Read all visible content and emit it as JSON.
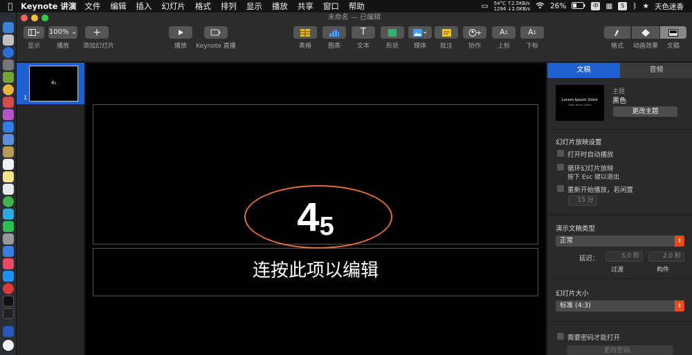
{
  "menubar": {
    "app_name": "Keynote 讲演",
    "items": [
      "文件",
      "编辑",
      "插入",
      "幻灯片",
      "格式",
      "排列",
      "显示",
      "播放",
      "共享",
      "窗口",
      "帮助"
    ],
    "status": {
      "net_line1": "54°C ↑2.5KB/s",
      "net_line2": "1294 ↓2.0KB/s",
      "battery": "26%",
      "input_method": "中",
      "user": "天色迷香"
    }
  },
  "window": {
    "title": "未命名 — 已编辑"
  },
  "toolbar": {
    "view": "显示",
    "zoom_value": "100%",
    "zoom": "播放",
    "add_slide": "添加幻灯片",
    "play": "播放",
    "keynote_live": "Keynote 直播",
    "table": "表格",
    "chart": "图表",
    "text": "文本",
    "shape": "形状",
    "media": "媒体",
    "comment": "批注",
    "collaborate": "协作",
    "superscript": "上标",
    "subscript": "下标",
    "format": "格式",
    "animate": "动画效果",
    "document": "文稿"
  },
  "navigator": {
    "slide_number": "1",
    "thumb_text": "4₅"
  },
  "slide": {
    "title_base": "4",
    "title_sub": "5",
    "body_placeholder": "连按此项以编辑"
  },
  "inspector": {
    "tabs": [
      "文稿",
      "音频"
    ],
    "theme_label": "主题",
    "theme_name": "黑色",
    "theme_thumb_title": "Lorem Ipsum Dolor",
    "theme_thumb_sub": "Dolor Ipsum Lorem",
    "change_theme": "更改主题",
    "slideshow_settings": "幻灯片放映设置",
    "autoplay": "打开时自动播放",
    "loop": "循环幻灯片放映",
    "loop_hint": "按下 Esc 键以退出",
    "restart_idle": "重新开始播放，若闲置",
    "idle_value": "15 分",
    "presentation_type": "演示文稿类型",
    "presentation_type_value": "正常",
    "delay_label": "延迟：",
    "transition_delay": "5.0 秒",
    "build_delay": "2.0 秒",
    "transition_label": "过渡",
    "build_label": "构件",
    "slide_size": "幻灯片大小",
    "slide_size_value": "标准 (4:3)",
    "require_password": "需要密码才能打开",
    "change_password": "更改密码..."
  },
  "colors": {
    "accent": "#1f5fcf",
    "popup_arrow": "#e74c1b",
    "highlight_ellipse": "#e2703a"
  }
}
